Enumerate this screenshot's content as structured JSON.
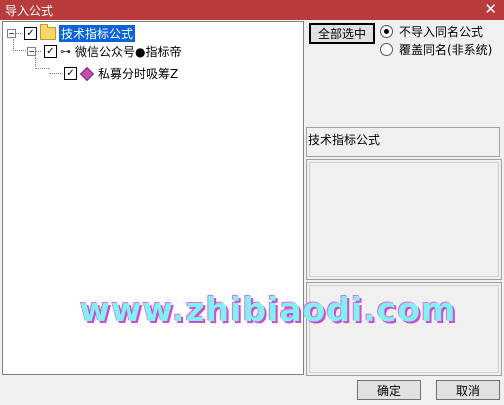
{
  "window": {
    "title": "导入公式",
    "close_glyph": "✕"
  },
  "tree": {
    "root": {
      "label": "技术指标公式",
      "checked": true,
      "expander": "−"
    },
    "child": {
      "label": "微信公众号●指标帝",
      "checked": true,
      "expander": "−"
    },
    "leaf": {
      "label": "私募分时吸筹Z",
      "checked": true
    }
  },
  "check_mark": "✓",
  "select_all_button": "全部选中",
  "options": [
    {
      "label": "不导入同名公式",
      "selected": true
    },
    {
      "label": "覆盖同名(非系统)",
      "selected": false
    }
  ],
  "category_label": "技术指标公式",
  "watermark": "www.zhibiaodi.com",
  "ok_button": "确定",
  "cancel_button": "取消"
}
